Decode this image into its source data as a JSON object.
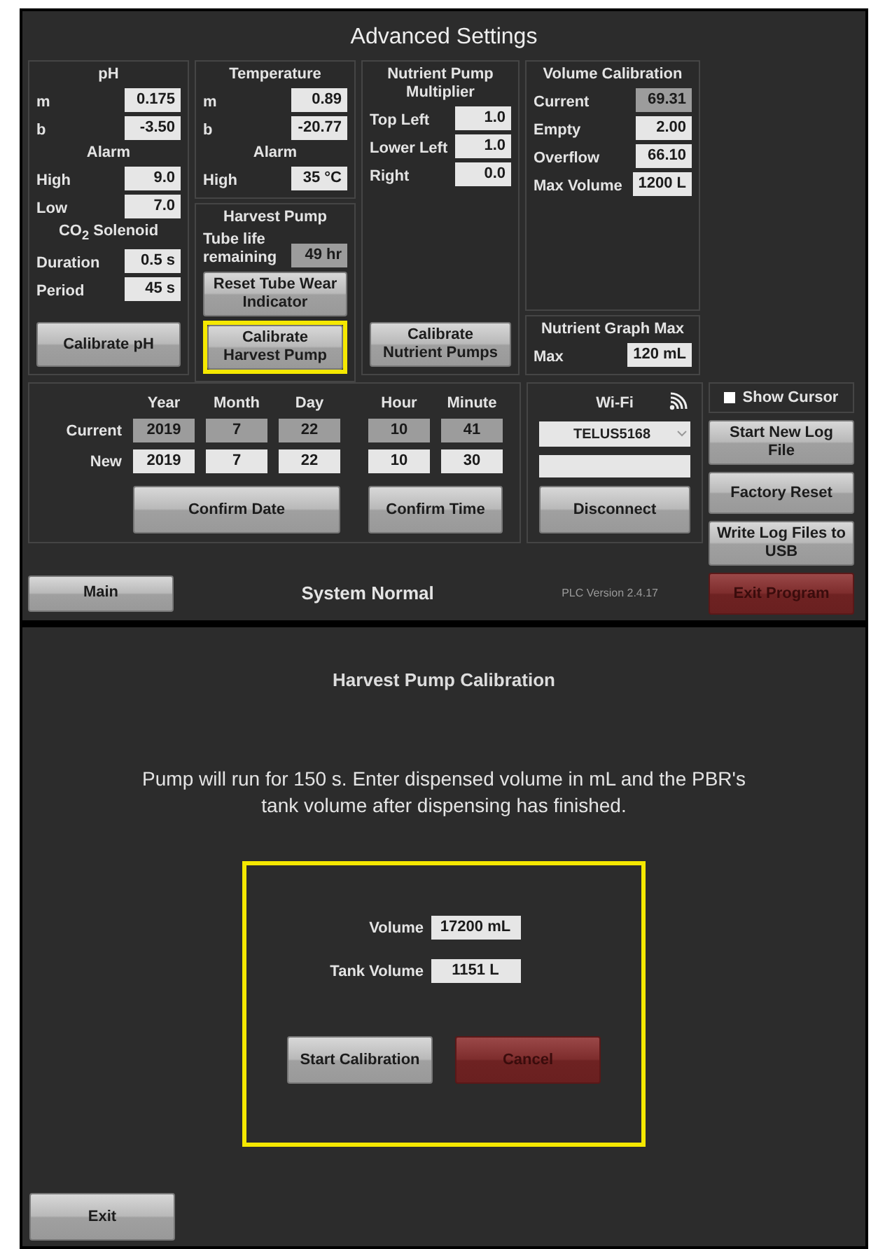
{
  "settings_screen": {
    "title": "Advanced Settings",
    "panel_columns": [
      [
        {
          "title": "pH",
          "items": [
            {
              "kind": "field",
              "label": "m",
              "value": "0.175",
              "readonly": false
            },
            {
              "kind": "field",
              "label": "b",
              "value": "-3.50",
              "readonly": false
            },
            {
              "kind": "heading",
              "text": "Alarm"
            },
            {
              "kind": "field",
              "label": "High",
              "value": "9.0",
              "readonly": false
            },
            {
              "kind": "field",
              "label": "Low",
              "value": "7.0",
              "readonly": false
            },
            {
              "kind": "heading",
              "text": "CO$_{2}$ Solenoid"
            },
            {
              "kind": "field",
              "label": "Duration",
              "value": "0.5 s",
              "readonly": false
            },
            {
              "kind": "field",
              "label": "Period",
              "value": "45 s",
              "readonly": false
            },
            {
              "kind": "button",
              "label": "Calibrate pH",
              "highlighted": false
            }
          ]
        }
      ],
      [
        {
          "title": "Temperature",
          "items": [
            {
              "kind": "field",
              "label": "m",
              "value": "0.89",
              "readonly": false
            },
            {
              "kind": "field",
              "label": "b",
              "value": "-20.77",
              "readonly": false
            },
            {
              "kind": "heading",
              "text": "Alarm"
            },
            {
              "kind": "field",
              "label": "High",
              "value": "35 °C",
              "readonly": false
            }
          ]
        },
        {
          "title": "Harvest Pump",
          "items": [
            {
              "kind": "field",
              "label": "Tube life remaining",
              "value": "49 hr",
              "readonly": true
            },
            {
              "kind": "button",
              "label": "Reset Tube Wear Indicator",
              "highlighted": false
            },
            {
              "kind": "button",
              "label": "Calibrate Harvest Pump",
              "highlighted": true
            }
          ]
        }
      ],
      [
        {
          "title": "Nutrient Pump Multiplier",
          "items": [
            {
              "kind": "field",
              "label": "Top Left",
              "value": "1.0",
              "readonly": false
            },
            {
              "kind": "field",
              "label": "Lower Left",
              "value": "1.0",
              "readonly": false
            },
            {
              "kind": "field",
              "label": "Right",
              "value": "0.0",
              "readonly": false
            },
            {
              "kind": "button",
              "label": "Calibrate Nutrient Pumps",
              "highlighted": false
            }
          ]
        }
      ],
      [
        {
          "title": "Volume Calibration",
          "items": [
            {
              "kind": "field",
              "label": "Current",
              "value": "69.31",
              "readonly": true
            },
            {
              "kind": "field",
              "label": "Empty",
              "value": "2.00",
              "readonly": false
            },
            {
              "kind": "field",
              "label": "Overflow",
              "value": "66.10",
              "readonly": false
            },
            {
              "kind": "field",
              "label": "Max Volume",
              "value": "1200 L",
              "readonly": false
            }
          ]
        },
        {
          "title": "Nutrient Graph Max",
          "items": [
            {
              "kind": "field",
              "label": "Max",
              "value": "120 mL",
              "readonly": false
            }
          ]
        }
      ]
    ],
    "datetime_panel": {
      "columns": [
        "Year",
        "Month",
        "Day",
        "Hour",
        "Minute"
      ],
      "rows": [
        {
          "label": "Current",
          "values": [
            "2019",
            "7",
            "22",
            "10",
            "41"
          ],
          "readonly": true
        },
        {
          "label": "New",
          "values": [
            "2019",
            "7",
            "22",
            "10",
            "30"
          ],
          "readonly": false
        }
      ],
      "buttons": [
        "Confirm Date",
        "Confirm Time"
      ]
    },
    "wifi_panel": {
      "title": "Wi-Fi",
      "network": "TELUS5168",
      "button": "Disconnect"
    },
    "show_cursor": {
      "label": "Show Cursor",
      "checked": false
    },
    "side_buttons": [
      {
        "label": "Start New Log File",
        "kind": "normal"
      },
      {
        "label": "Factory Reset",
        "kind": "normal"
      },
      {
        "label": "Write Log Files to USB",
        "kind": "normal"
      },
      {
        "label": "Exit Program",
        "kind": "danger"
      }
    ],
    "footer": {
      "button": "Main",
      "status": "System Normal",
      "version": "PLC Version 2.4.17"
    }
  },
  "calibration_screen": {
    "title": "Harvest Pump Calibration",
    "message": "Pump will run for 150 s. Enter dispensed volume in mL and the PBR's tank volume after dispensing has finished.",
    "field_box": {
      "highlighted": true,
      "fields": [
        {
          "label": "Volume",
          "value": "17200 mL"
        },
        {
          "label": "Tank Volume",
          "value": "1151 L"
        }
      ],
      "buttons": [
        {
          "label": "Start Calibration",
          "kind": "normal"
        },
        {
          "label": "Cancel",
          "kind": "danger"
        }
      ]
    },
    "exit_button": "Exit"
  }
}
